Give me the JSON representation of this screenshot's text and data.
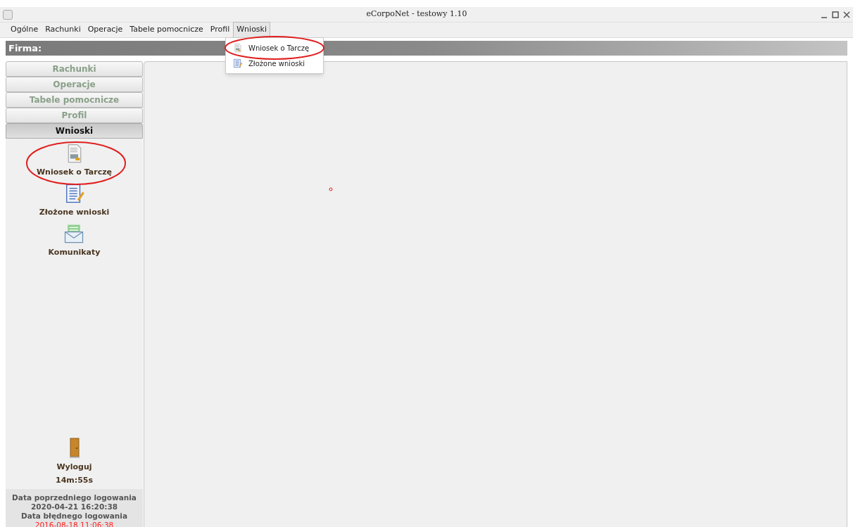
{
  "window": {
    "title": "eCorpoNet - testowy 1.10"
  },
  "menu": [
    {
      "label": "Ogólne",
      "selected": false
    },
    {
      "label": "Rachunki",
      "selected": false
    },
    {
      "label": "Operacje",
      "selected": false
    },
    {
      "label": "Tabele pomocnicze",
      "selected": false
    },
    {
      "label": "Profil",
      "selected": false
    },
    {
      "label": "Wnioski",
      "selected": true
    }
  ],
  "dropdown": [
    {
      "label": "Wniosek o Tarczę",
      "kind": "form"
    },
    {
      "label": "Złożone wnioski",
      "kind": "list"
    }
  ],
  "company_bar": {
    "label": "Firma:"
  },
  "sidebar": {
    "sections": [
      {
        "label": "Rachunki",
        "selected": false
      },
      {
        "label": "Operacje",
        "selected": false
      },
      {
        "label": "Tabele pomocnicze",
        "selected": false
      },
      {
        "label": "Profil",
        "selected": false
      },
      {
        "label": "Wnioski",
        "selected": true
      }
    ],
    "items": [
      {
        "label": "Wniosek o Tarczę",
        "kind": "form"
      },
      {
        "label": "Złożone wnioski",
        "kind": "list"
      },
      {
        "label": "Komunikaty",
        "kind": "mail"
      }
    ],
    "logout": {
      "label": "Wyloguj",
      "timer": "14m:55s"
    },
    "login_info": [
      {
        "text": "Data poprzedniego logowania",
        "warning": false
      },
      {
        "text": "2020-04-21 16:20:38",
        "warning": false
      },
      {
        "text": "Data błędnego logowania",
        "warning": false
      },
      {
        "text": "2016-08-18 11:06:38",
        "warning": true
      }
    ]
  }
}
